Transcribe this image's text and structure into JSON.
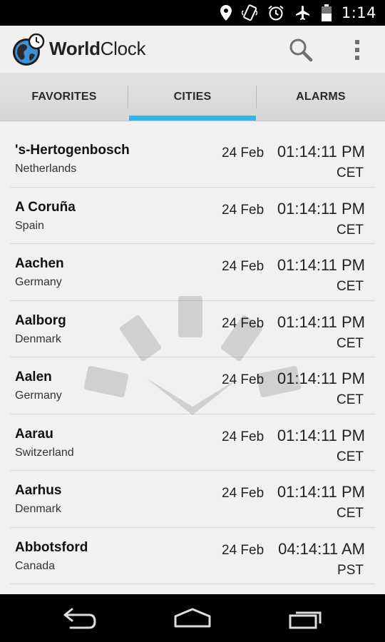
{
  "status_bar": {
    "time": "1:14",
    "icons": [
      "location-icon",
      "vibrate-icon",
      "alarm-icon",
      "airplane-icon",
      "battery-icon"
    ]
  },
  "app": {
    "title_bold": "World",
    "title_regular": "Clock"
  },
  "tabs": [
    {
      "label": "FAVORITES",
      "selected": false
    },
    {
      "label": "CITIES",
      "selected": true
    },
    {
      "label": "ALARMS",
      "selected": false
    }
  ],
  "cities": [
    {
      "name": "'s-Hertogenbosch",
      "country": "Netherlands",
      "date": "24 Feb",
      "time": "01:14:11 PM",
      "tz": "CET"
    },
    {
      "name": "A Coruña",
      "country": "Spain",
      "date": "24 Feb",
      "time": "01:14:11 PM",
      "tz": "CET"
    },
    {
      "name": "Aachen",
      "country": "Germany",
      "date": "24 Feb",
      "time": "01:14:11 PM",
      "tz": "CET"
    },
    {
      "name": "Aalborg",
      "country": "Denmark",
      "date": "24 Feb",
      "time": "01:14:11 PM",
      "tz": "CET"
    },
    {
      "name": "Aalen",
      "country": "Germany",
      "date": "24 Feb",
      "time": "01:14:11 PM",
      "tz": "CET"
    },
    {
      "name": "Aarau",
      "country": "Switzerland",
      "date": "24 Feb",
      "time": "01:14:11 PM",
      "tz": "CET"
    },
    {
      "name": "Aarhus",
      "country": "Denmark",
      "date": "24 Feb",
      "time": "01:14:11 PM",
      "tz": "CET"
    },
    {
      "name": "Abbotsford",
      "country": "Canada",
      "date": "24 Feb",
      "time": "04:14:11 AM",
      "tz": "PST"
    }
  ],
  "colors": {
    "accent": "#33b5e5",
    "status_bar": "#000000",
    "action_bar": "#f0f0f0"
  }
}
